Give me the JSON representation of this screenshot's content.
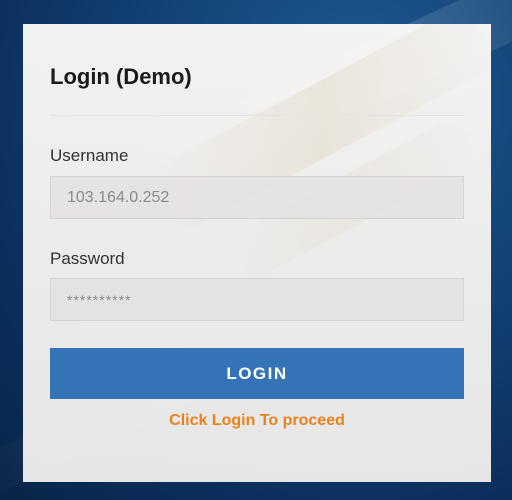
{
  "login_form": {
    "title": "Login (Demo)",
    "username_label": "Username",
    "username_value": "103.164.0.252",
    "password_label": "Password",
    "password_value": "**********",
    "login_button_label": "LOGIN",
    "hint_text": "Click Login To proceed"
  },
  "colors": {
    "background_primary": "#134377",
    "card_background": "#f6f3f0",
    "button_primary": "#3474b6",
    "button_text": "#ffffff",
    "hint_accent": "#e8821c",
    "title_text": "#1b1b1b"
  }
}
